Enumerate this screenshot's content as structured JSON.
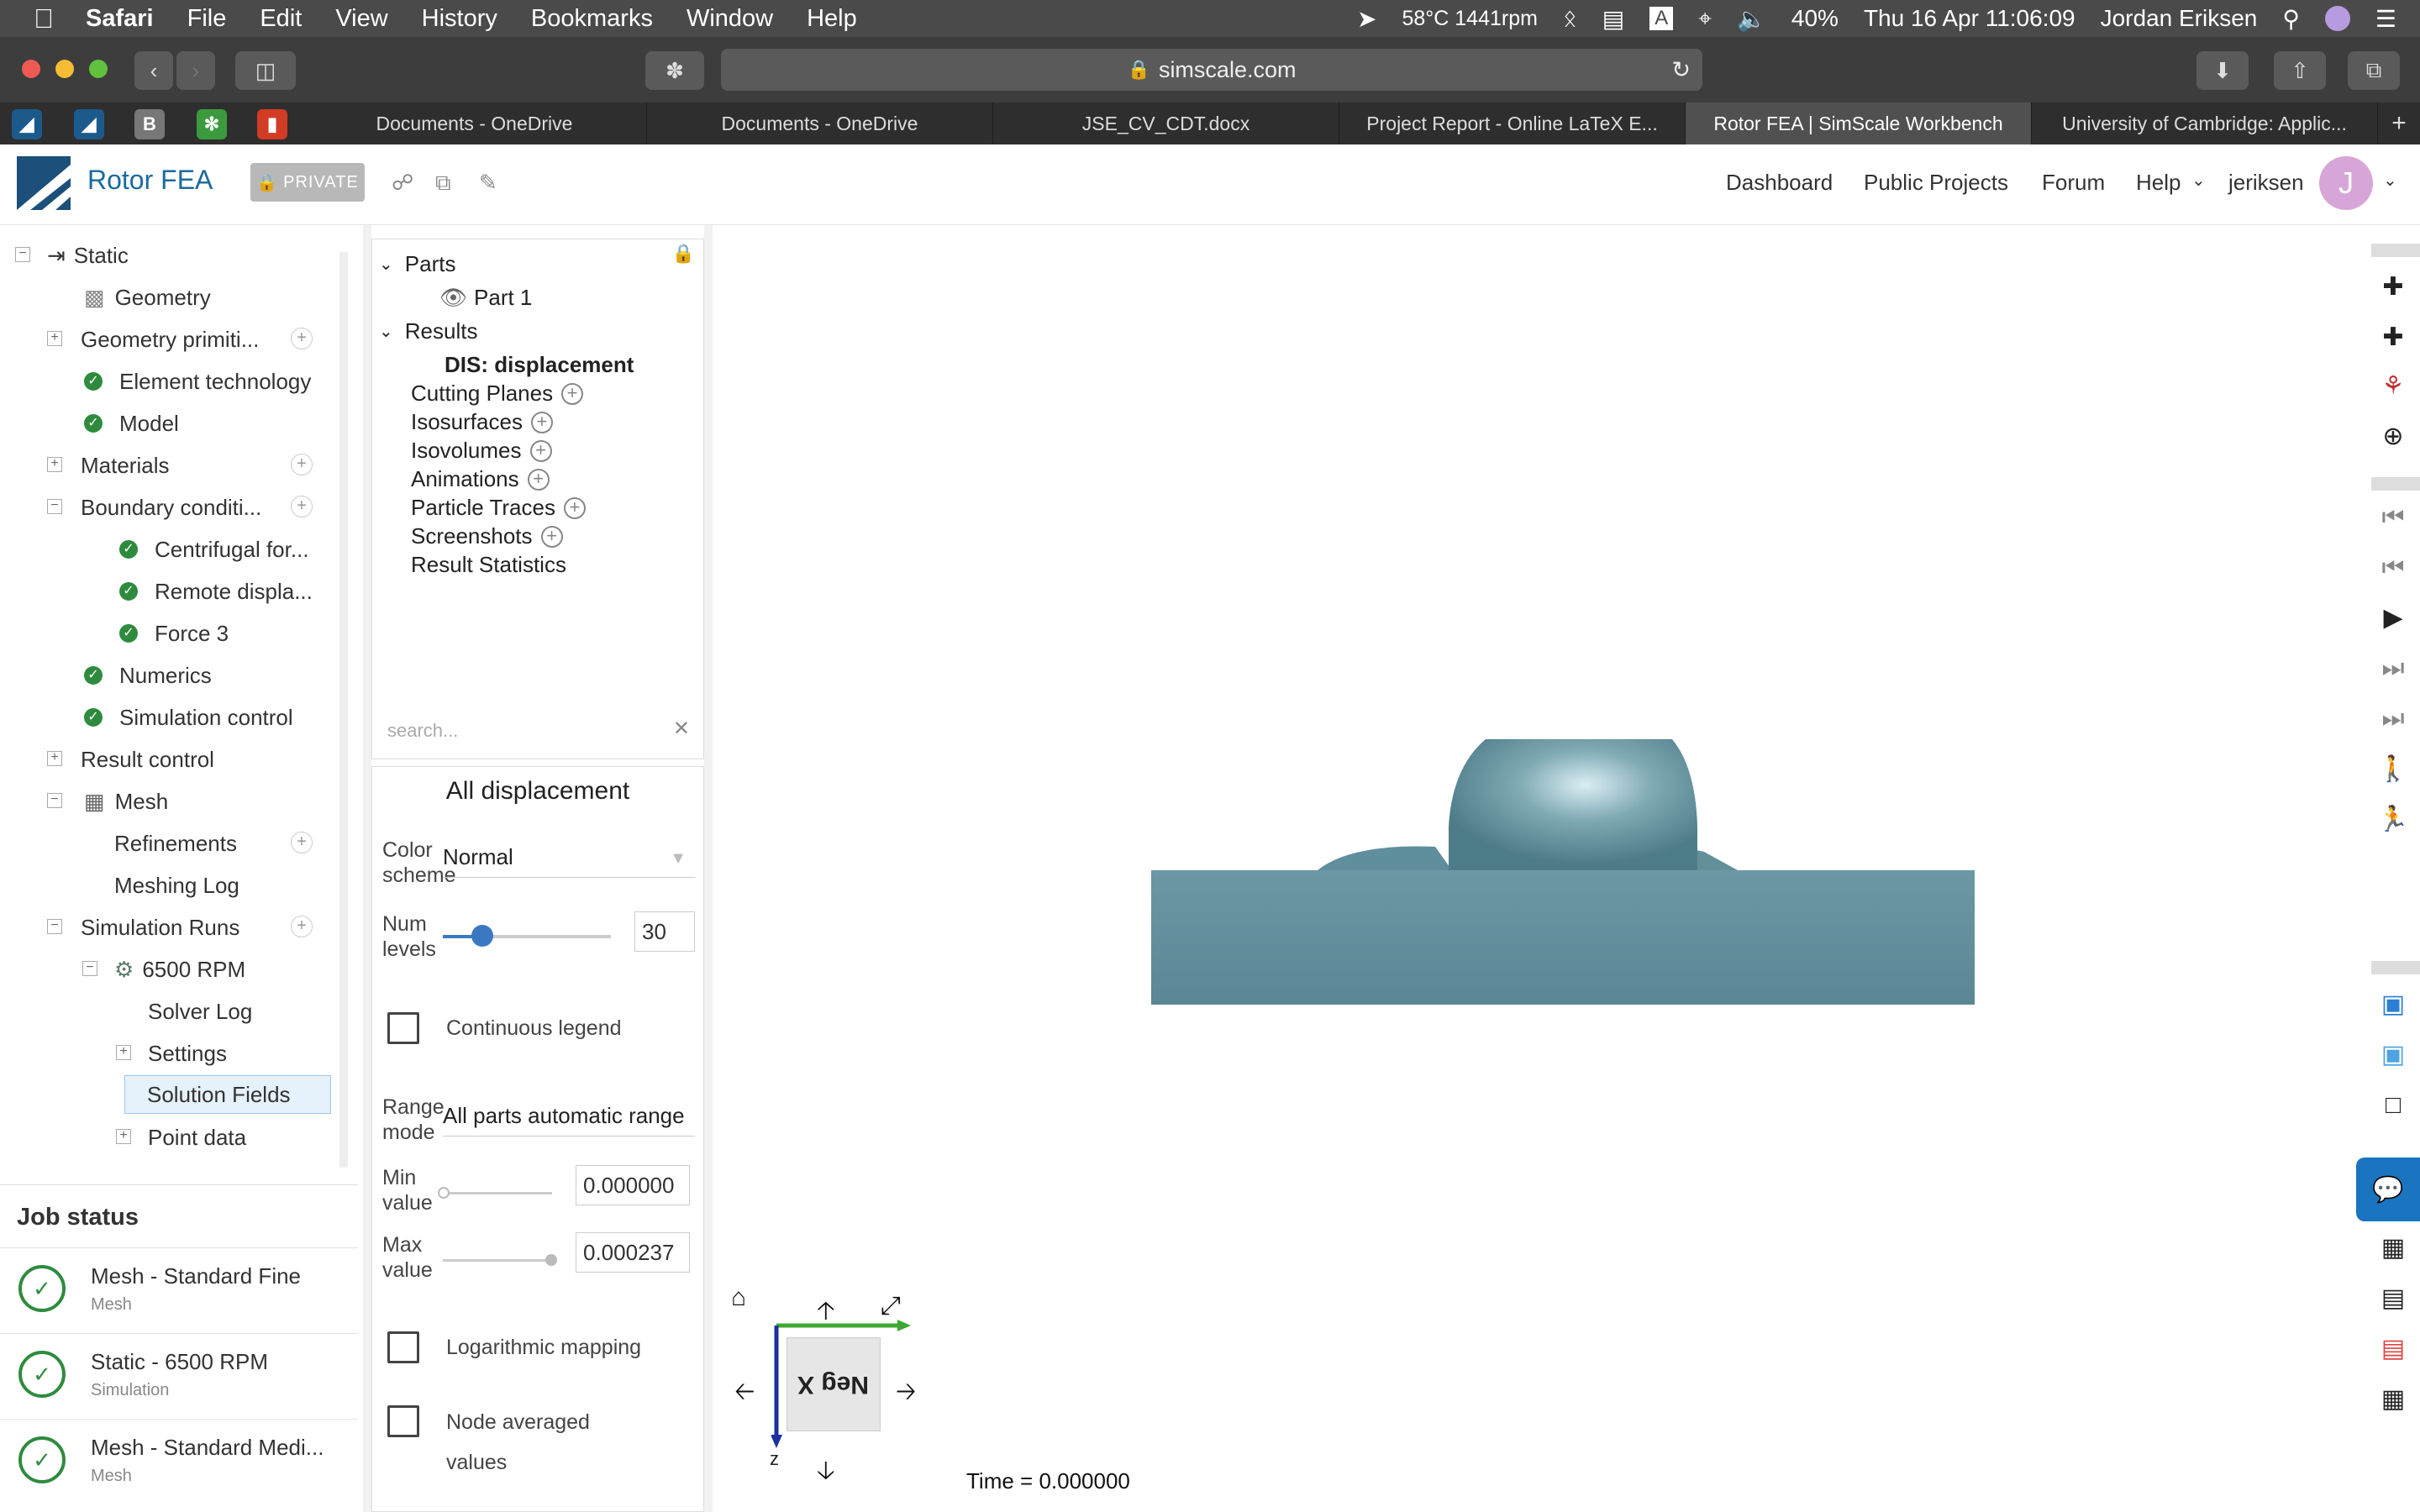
{
  "menubar": {
    "app": "Safari",
    "items": [
      "File",
      "Edit",
      "View",
      "History",
      "Bookmarks",
      "Window",
      "Help"
    ],
    "status_temp": "58°C 1441rpm",
    "battery": "40%",
    "datetime": "Thu 16 Apr  11:06:09",
    "user": "Jordan Eriksen"
  },
  "browser": {
    "url": "simscale.com",
    "tabs": [
      "Documents - OneDrive",
      "Documents - OneDrive",
      "JSE_CV_CDT.docx",
      "Project Report - Online LaTeX E...",
      "Rotor FEA | SimScale Workbench",
      "University of Cambridge: Applic..."
    ],
    "active_tab": 4
  },
  "header": {
    "project_name": "Rotor FEA",
    "private_label": "PRIVATE",
    "nav": [
      "Dashboard",
      "Public Projects",
      "Forum",
      "Help"
    ],
    "username": "jeriksen",
    "avatar_letter": "J"
  },
  "tree": {
    "static": "Static",
    "geometry": "Geometry",
    "geometry_primitives": "Geometry primiti...",
    "element_technology": "Element technology",
    "model": "Model",
    "materials": "Materials",
    "boundary_conditions": "Boundary conditi...",
    "centrifugal": "Centrifugal for...",
    "remote_displacement": "Remote displa...",
    "force3": "Force 3",
    "numerics": "Numerics",
    "simulation_control": "Simulation control",
    "result_control": "Result control",
    "mesh": "Mesh",
    "refinements": "Refinements",
    "meshing_log": "Meshing Log",
    "simulation_runs": "Simulation Runs",
    "run_6500": "6500 RPM",
    "solver_log": "Solver Log",
    "settings": "Settings",
    "solution_fields": "Solution Fields",
    "point_data": "Point data"
  },
  "jobs": {
    "title": "Job status",
    "items": [
      {
        "name": "Mesh - Standard Fine",
        "type": "Mesh"
      },
      {
        "name": "Static - 6500 RPM",
        "type": "Simulation"
      },
      {
        "name": "Mesh - Standard Medi...",
        "type": "Mesh"
      }
    ]
  },
  "postproc": {
    "parts": "Parts",
    "part1": "Part 1",
    "results": "Results",
    "dis": "DIS: displacement",
    "cutting_planes": "Cutting Planes",
    "isosurfaces": "Isosurfaces",
    "isovolumes": "Isovolumes",
    "animations": "Animations",
    "particle_traces": "Particle Traces",
    "screenshots": "Screenshots",
    "result_statistics": "Result Statistics",
    "search_placeholder": "search..."
  },
  "settings": {
    "title": "All displacement",
    "color_scheme_label": "Color scheme",
    "color_scheme_value": "Normal",
    "num_levels_label": "Num levels",
    "num_levels_value": "30",
    "num_levels_fraction": 0.2,
    "continuous_legend": "Continuous legend",
    "range_mode_label": "Range mode",
    "range_mode_value": "All parts automatic range",
    "min_label": "Min value",
    "min_value": "0.000000",
    "max_label": "Max value",
    "max_value": "0.000237",
    "log_mapping": "Logarithmic mapping",
    "node_averaged": "Node averaged values"
  },
  "viewport": {
    "time": "Time = 0.000000",
    "cube_face": "Neg X",
    "axis_z": "z",
    "model_color": "#5f8f9c"
  }
}
